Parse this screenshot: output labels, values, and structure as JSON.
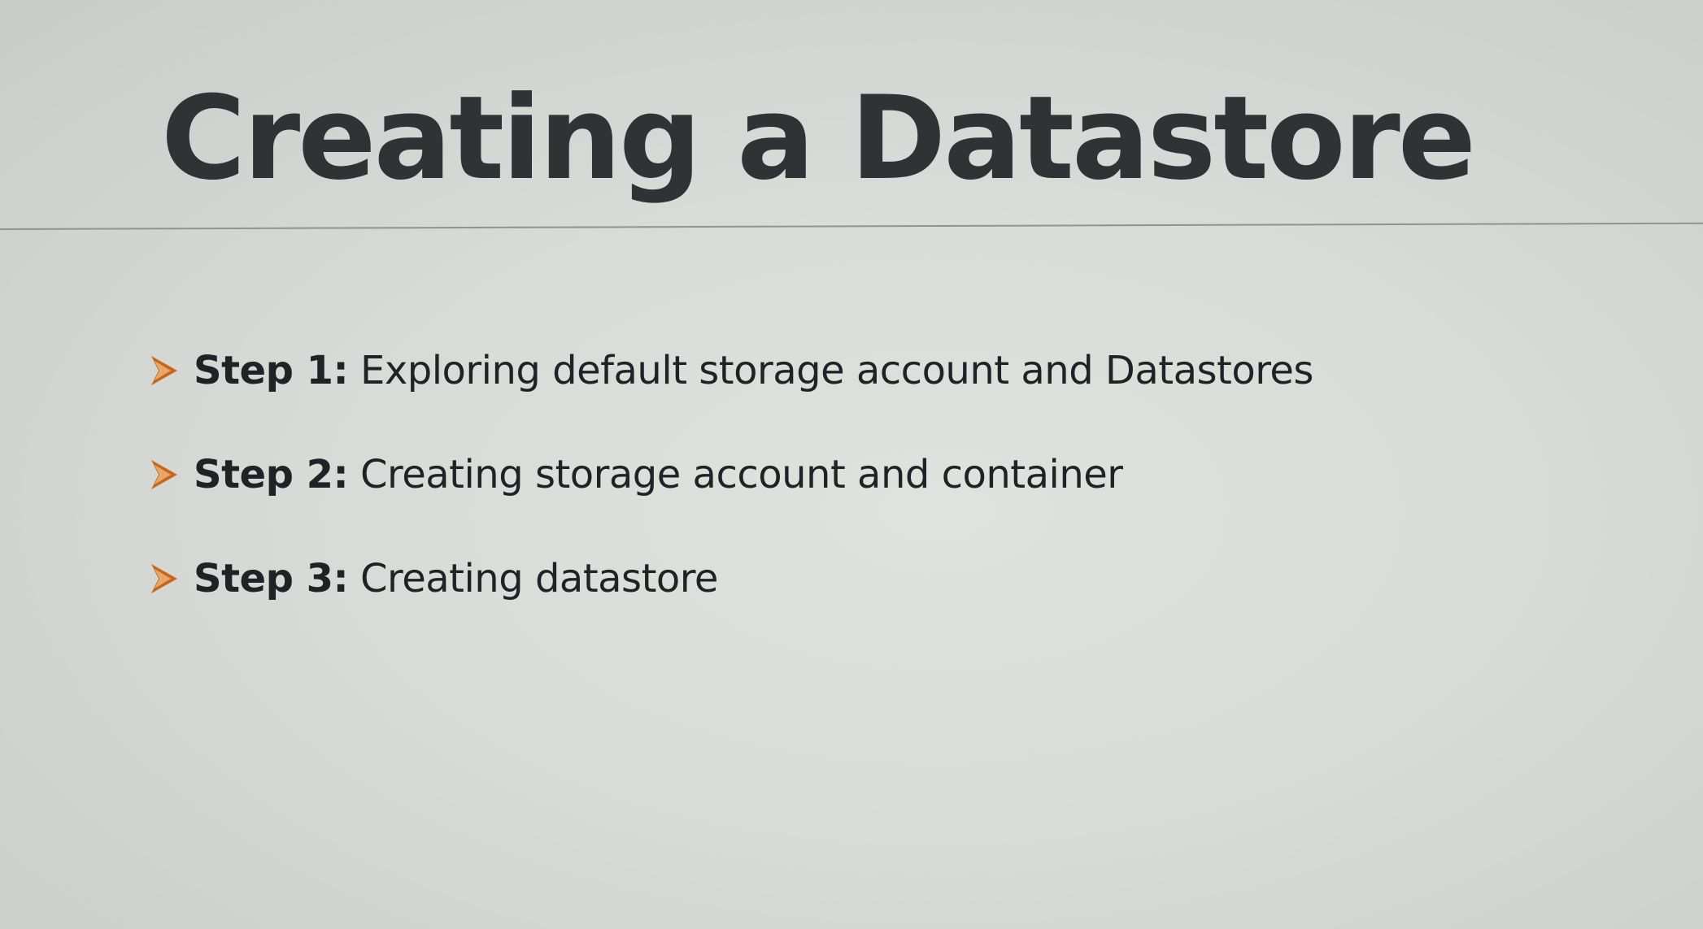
{
  "slide": {
    "title": "Creating a Datastore",
    "steps": [
      {
        "label": "Step 1:",
        "text": " Exploring default storage account and Datastores"
      },
      {
        "label": "Step 2:",
        "text": " Creating storage account and container"
      },
      {
        "label": "Step 3:",
        "text": " Creating datastore"
      }
    ]
  },
  "colors": {
    "bullet_accent": "#c9661e",
    "title_text": "#2f3336",
    "body_text": "#1f2326"
  },
  "icons": {
    "bullet": "arrowhead-bullet-icon"
  }
}
